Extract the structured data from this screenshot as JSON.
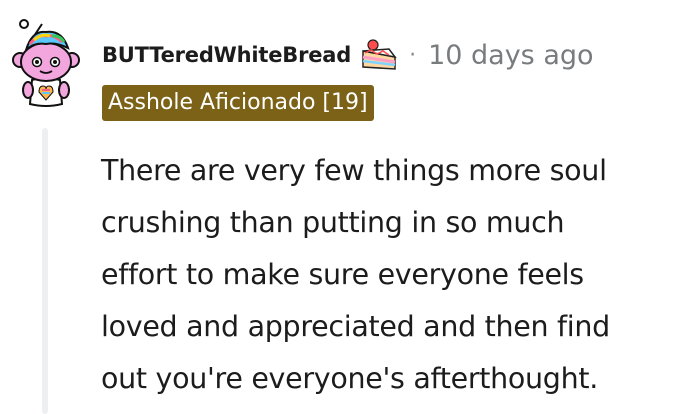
{
  "comment": {
    "username": "BUTTeredWhiteBread",
    "separator": "·",
    "timestamp": "10 days ago",
    "flair": "Asshole Aficionado [19]",
    "body_lines": [
      "There are very few things more soul",
      "crushing than putting in so much",
      "effort to make sure everyone feels",
      "loved and appreciated and then find",
      "out you're everyone's afterthought."
    ]
  },
  "icons": {
    "avatar": "snoo-avatar-icon",
    "cake_day": "cake-icon"
  },
  "colors": {
    "flair_bg": "#7c6217",
    "flair_text": "#ffffff",
    "thread_line": "#edeff1",
    "meta_text": "#787c7e"
  }
}
